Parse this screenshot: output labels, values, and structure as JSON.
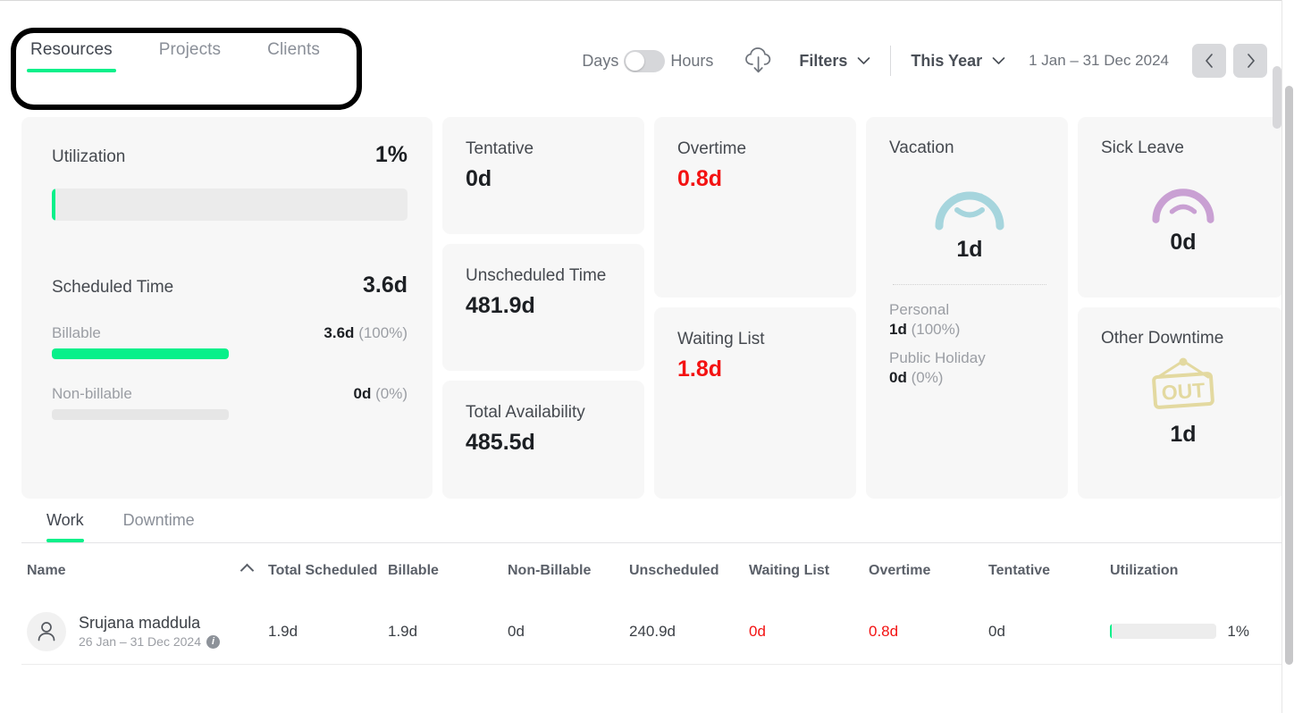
{
  "header": {
    "tabs": [
      {
        "label": "Resources",
        "active": true
      },
      {
        "label": "Projects",
        "active": false
      },
      {
        "label": "Clients",
        "active": false
      }
    ],
    "unit_toggle": {
      "left_label": "Days",
      "right_label": "Hours",
      "selected": "Days"
    },
    "export_icon": "cloud-download-icon",
    "filters_label": "Filters",
    "period_label": "This Year",
    "date_range": "1 Jan – 31 Dec 2024",
    "prev_label": "‹",
    "next_label": "›"
  },
  "colors": {
    "accent_green": "#08f08a",
    "danger_red": "#f31212",
    "card_bg": "#f7f7f7",
    "vacation_icon": "#a6d5dd",
    "sick_icon": "#c9a0d3",
    "out_icon": "#e3d9a0"
  },
  "cards": {
    "utilization": {
      "title": "Utilization",
      "percent_label": "1%",
      "percent_value": 1,
      "scheduled_label": "Scheduled Time",
      "scheduled_value": "3.6d",
      "billable": {
        "label": "Billable",
        "value": "3.6d",
        "percent_label": "(100%)",
        "percent_value": 100
      },
      "non_billable": {
        "label": "Non-billable",
        "value": "0d",
        "percent_label": "(0%)",
        "percent_value": 0
      }
    },
    "tentative": {
      "label": "Tentative",
      "value": "0d"
    },
    "unscheduled_time": {
      "label": "Unscheduled Time",
      "value": "481.9d"
    },
    "total_availability": {
      "label": "Total Availability",
      "value": "485.5d"
    },
    "overtime": {
      "label": "Overtime",
      "value": "0.8d",
      "is_danger": true
    },
    "waiting_list": {
      "label": "Waiting List",
      "value": "1.8d",
      "is_danger": true
    },
    "vacation": {
      "label": "Vacation",
      "icon": "smiley-face-icon",
      "value": "1d",
      "breakdown": [
        {
          "label": "Personal",
          "value": "1d",
          "percent_label": "(100%)"
        },
        {
          "label": "Public Holiday",
          "value": "0d",
          "percent_label": "(0%)"
        }
      ]
    },
    "sick_leave": {
      "label": "Sick Leave",
      "icon": "sad-face-icon",
      "value": "0d"
    },
    "other_downtime": {
      "label": "Other Downtime",
      "icon": "out-sign-icon",
      "icon_text": "OUT",
      "value": "1d"
    }
  },
  "table": {
    "tabs": [
      {
        "label": "Work",
        "active": true
      },
      {
        "label": "Downtime",
        "active": false
      }
    ],
    "columns": [
      "Name",
      "Total Scheduled",
      "Billable",
      "Non-Billable",
      "Unscheduled",
      "Waiting List",
      "Overtime",
      "Tentative",
      "Utilization"
    ],
    "sort": {
      "column": "Name",
      "direction": "asc",
      "icon": "chevron-up-icon"
    },
    "rows": [
      {
        "avatar_icon": "person-icon",
        "name": "Srujana maddula",
        "date_range": "26 Jan – 31 Dec 2024",
        "info_icon": "info-icon",
        "total_scheduled": "1.9d",
        "billable": "1.9d",
        "non_billable": "0d",
        "unscheduled": "240.9d",
        "waiting_list": "0d",
        "waiting_list_danger": true,
        "overtime": "0.8d",
        "overtime_danger": true,
        "tentative": "0d",
        "utilization_label": "1%",
        "utilization_value": 1
      }
    ]
  }
}
